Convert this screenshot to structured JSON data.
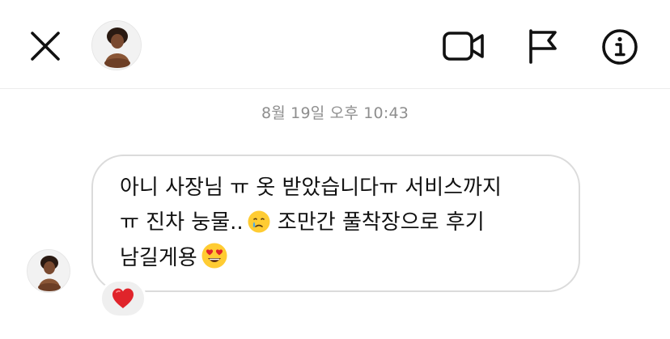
{
  "header": {
    "close_icon": "close-icon",
    "video_icon": "video-camera-icon",
    "flag_icon": "flag-icon",
    "info_icon": "info-icon"
  },
  "conversation": {
    "timestamp": "8월 19일 오후 10:43",
    "message": {
      "line1": "아니 사장님 ㅠ 옷 받았습니다ㅠ 서비스까지",
      "line2_before": "ㅠ 진차 눙물..",
      "line2_emoji": "crying-face-emoji",
      "line2_after": " 조만간 풀착장으로 후기",
      "line3": "남길게용",
      "line3_emoji": "heart-eyes-emoji"
    },
    "reaction": "red-heart-emoji"
  },
  "colors": {
    "border": "#dbdbdb",
    "timestamp": "#8e8e8e",
    "reaction_bg": "#efefef",
    "heart": "#e0242b"
  }
}
